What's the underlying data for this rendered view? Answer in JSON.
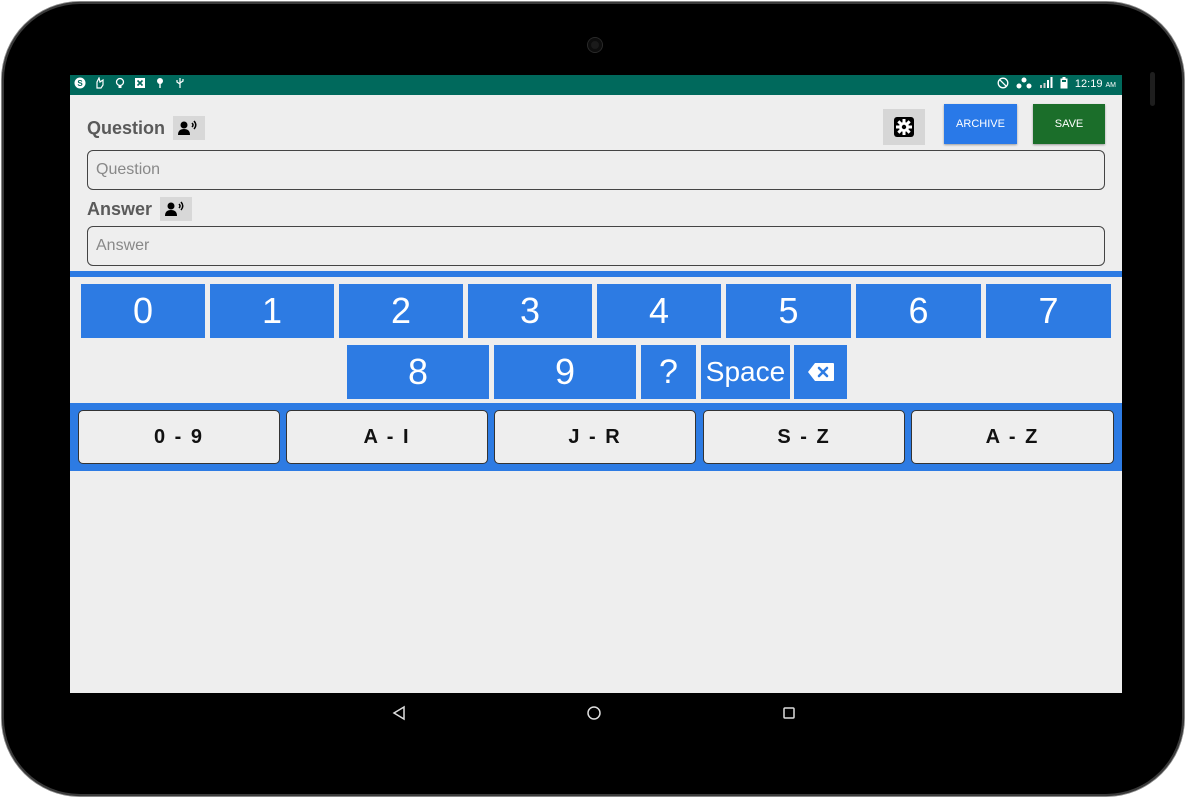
{
  "status_bar": {
    "left_icons": [
      "skype-icon",
      "hand-icon",
      "bulb-icon",
      "close-box-icon",
      "pin-icon",
      "usb-icon"
    ],
    "right_icons": [
      "do-not-disturb-icon",
      "network-icon",
      "signal-icon",
      "battery-icon"
    ],
    "time": "12:19",
    "ampm": "AM"
  },
  "form": {
    "question_label": "Question",
    "question_placeholder": "Question",
    "question_value": "",
    "answer_label": "Answer",
    "answer_placeholder": "Answer",
    "answer_value": ""
  },
  "toolbar": {
    "archive_label": "ARCHIVE",
    "save_label": "SAVE"
  },
  "keyboard": {
    "row1": [
      "0",
      "1",
      "2",
      "3",
      "4",
      "5",
      "6",
      "7"
    ],
    "row2": [
      "8",
      "9",
      "?",
      "Space"
    ],
    "tabs": [
      "0 - 9",
      "A - I",
      "J - R",
      "S - Z",
      "A - Z"
    ],
    "selected_tab": "0 - 9"
  },
  "colors": {
    "status_bar": "#00695c",
    "keyboard_blue": "#2d7be3",
    "archive_blue": "#2979e8",
    "save_green": "#1b6e2a"
  }
}
